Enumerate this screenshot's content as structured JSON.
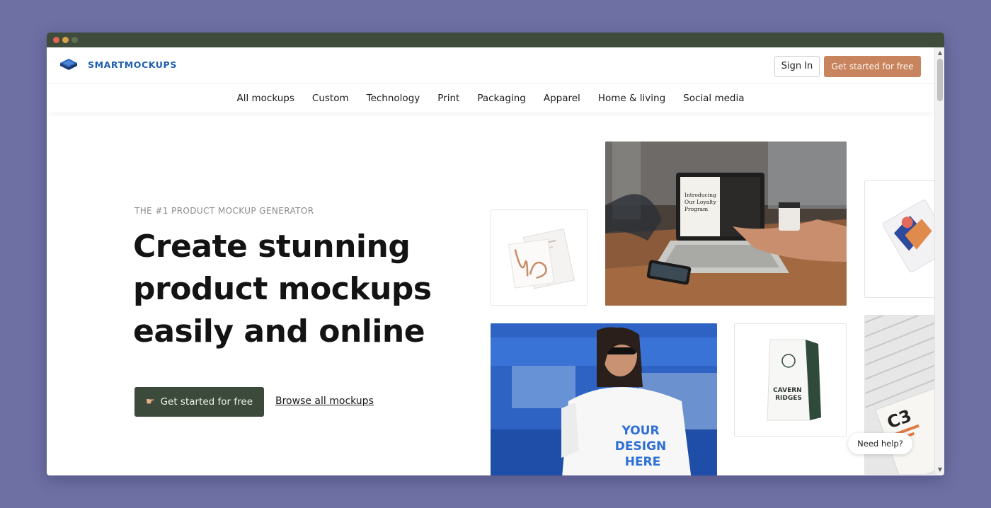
{
  "brand": {
    "name": "SMARTMOCKUPS"
  },
  "header": {
    "signin_label": "Sign In",
    "cta_label": "Get started for free"
  },
  "nav": {
    "items": [
      "All mockups",
      "Custom",
      "Technology",
      "Print",
      "Packaging",
      "Apparel",
      "Home & living",
      "Social media"
    ]
  },
  "hero": {
    "eyebrow": "THE #1 PRODUCT MOCKUP GENERATOR",
    "headline_line1": "Create stunning",
    "headline_line2": "product mockups",
    "headline_line3": "easily and online",
    "cta_label": "Get started for free",
    "browse_label": "Browse all mockups"
  },
  "mockups": {
    "laptop_screen_text": "Introducing Our Loyalty Program",
    "tshirt_text_line1": "YOUR",
    "tshirt_text_line2": "DESIGN",
    "tshirt_text_line3": "HERE",
    "coffee_text_line1": "CAVERN",
    "coffee_text_line2": "RIDGES",
    "print_text": "C3"
  },
  "help": {
    "label": "Need help?"
  },
  "colors": {
    "background": "#6e6fa3",
    "titlebar": "#3f4c3b",
    "brand_blue": "#1f5fae",
    "cta_orange": "#c8845f",
    "cta_green": "#3b4a3a"
  },
  "icons": [
    "window-close-dot",
    "window-minimize-dot",
    "window-maximize-dot",
    "smartmockups-logo-icon",
    "pointing-hand-icon",
    "scroll-up-arrow",
    "scroll-down-arrow"
  ]
}
